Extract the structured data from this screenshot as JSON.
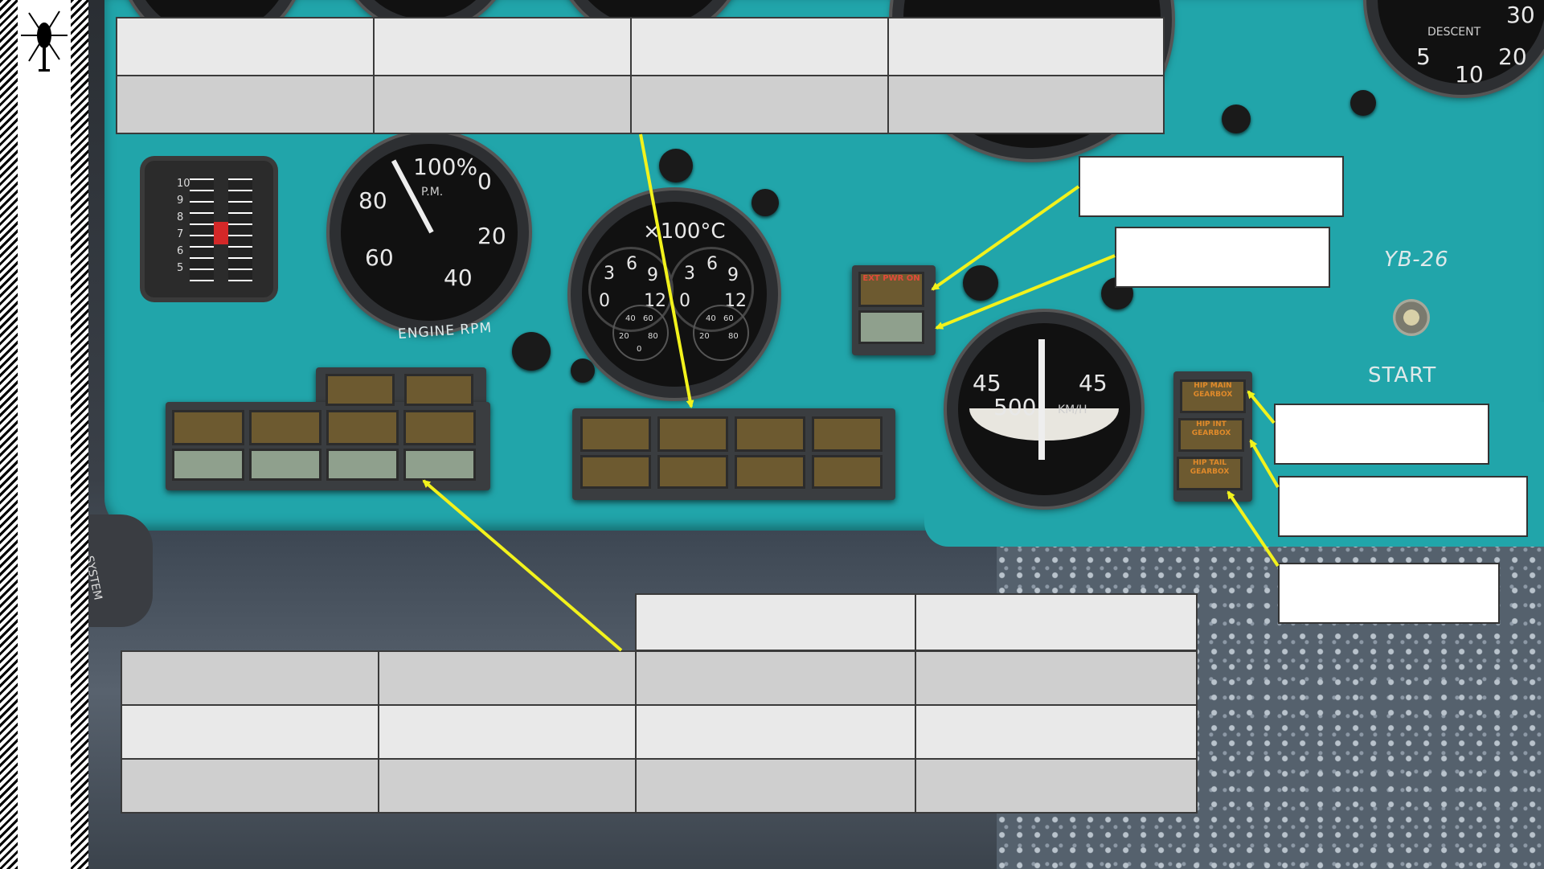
{
  "panel": {
    "rpm_gauge": {
      "label": "ENGINE RPM",
      "center_text": "100%",
      "unit": "P.M.",
      "scale": [
        "0",
        "20",
        "40",
        "60",
        "80"
      ]
    },
    "temp_gauge": {
      "title": "×100°C",
      "scale": [
        "3",
        "6",
        "9",
        "12",
        "0"
      ],
      "sub_scale": [
        "40",
        "60",
        "20",
        "80",
        "0"
      ]
    },
    "airspeed_gauge": {
      "scale": [
        "45",
        "500",
        "45"
      ],
      "unit": "KM/H"
    },
    "vvi_gauge": {
      "label": "DESCENT",
      "scale": [
        "5",
        "10",
        "20",
        "30"
      ]
    },
    "engine_display_scale": [
      "10",
      "9",
      "8",
      "7",
      "6",
      "5"
    ],
    "ext_pwr_lamp": "EXT PWR ON",
    "gearbox_lamps": [
      "HIP MAIN GEARBOX",
      "HIP INT GEARBOX",
      "HIP TAIL GEARBOX"
    ],
    "yb_label": "YB-26",
    "start_label": "START",
    "side_label": "SYSTEM RIGHT"
  },
  "colors": {
    "panel": "#21a5aa",
    "arrow": "#f2f21c",
    "table_light": "#e9e9e9",
    "table_dark": "#cfcfcf"
  },
  "icons": {
    "logo": "helicopter-icon"
  }
}
